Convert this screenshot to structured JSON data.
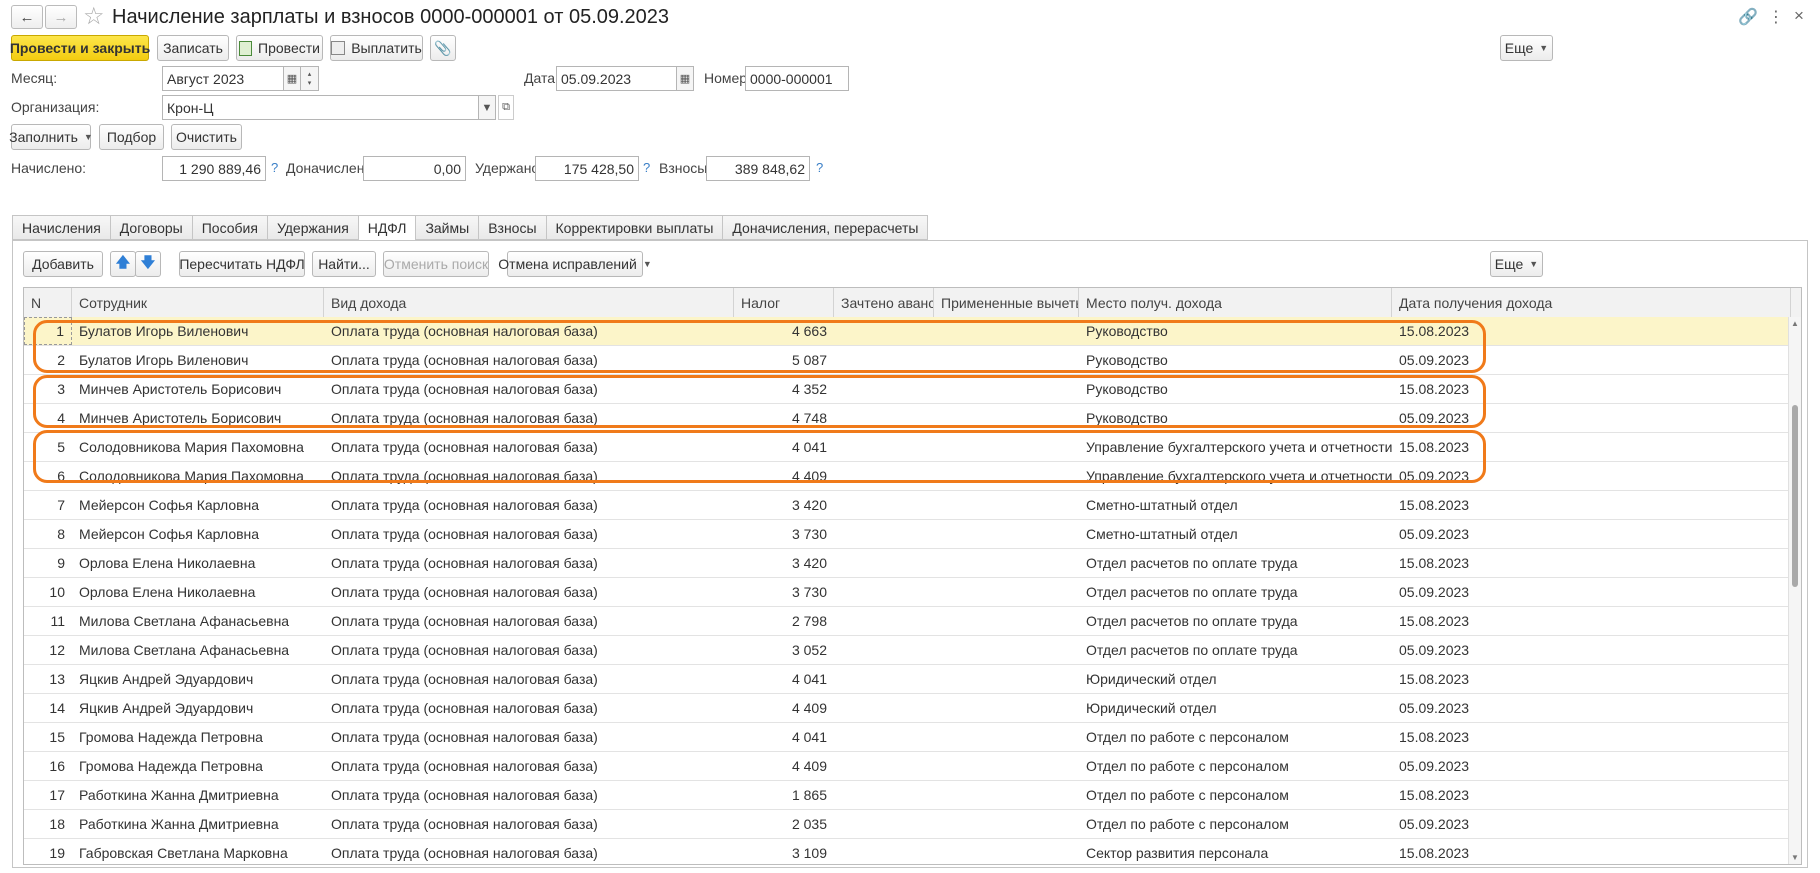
{
  "window": {
    "title": "Начисление зарплаты и взносов 0000-000001 от 05.09.2023",
    "more_label": "Еще"
  },
  "toolbar": {
    "post_close": "Провести и закрыть",
    "save": "Записать",
    "post": "Провести",
    "pay": "Выплатить",
    "more": "Еще"
  },
  "form": {
    "month_label": "Месяц:",
    "month_value": "Август 2023",
    "date_label": "Дата:",
    "date_value": "05.09.2023",
    "number_label": "Номер:",
    "number_value": "0000-000001",
    "org_label": "Организация:",
    "org_value": "Крон-Ц"
  },
  "actions": {
    "fill": "Заполнить",
    "select": "Подбор",
    "clear": "Очистить"
  },
  "totals": {
    "accrued_label": "Начислено:",
    "accrued_value": "1 290 889,46",
    "extra_label": "Доначислено:",
    "extra_value": "0,00",
    "withheld_label": "Удержано:",
    "withheld_value": "175 428,50",
    "contrib_label": "Взносы:",
    "contrib_value": "389 848,62",
    "q": "?"
  },
  "tabs": [
    "Начисления",
    "Договоры",
    "Пособия",
    "Удержания",
    "НДФЛ",
    "Займы",
    "Взносы",
    "Корректировки выплаты",
    "Доначисления, перерасчеты"
  ],
  "active_tab": 4,
  "table_toolbar": {
    "add": "Добавить",
    "recalc": "Пересчитать НДФЛ",
    "find": "Найти...",
    "cancel_search": "Отменить поиск",
    "cancel_fix": "Отмена исправлений",
    "more": "Еще"
  },
  "table": {
    "columns": [
      "N",
      "Сотрудник",
      "Вид дохода",
      "Налог",
      "Зачтено авансов",
      "Примененные вычеты",
      "Место получ. дохода",
      "Дата получения дохода"
    ],
    "rows": [
      [
        "1",
        "Булатов Игорь Виленович",
        "Оплата труда (основная налоговая база)",
        "4 663",
        "",
        "",
        "Руководство",
        "15.08.2023"
      ],
      [
        "2",
        "Булатов Игорь Виленович",
        "Оплата труда (основная налоговая база)",
        "5 087",
        "",
        "",
        "Руководство",
        "05.09.2023"
      ],
      [
        "3",
        "Минчев Аристотель Борисович",
        "Оплата труда (основная налоговая база)",
        "4 352",
        "",
        "",
        "Руководство",
        "15.08.2023"
      ],
      [
        "4",
        "Минчев Аристотель Борисович",
        "Оплата труда (основная налоговая база)",
        "4 748",
        "",
        "",
        "Руководство",
        "05.09.2023"
      ],
      [
        "5",
        "Солодовникова Мария Пахомовна",
        "Оплата труда (основная налоговая база)",
        "4 041",
        "",
        "",
        "Управление бухгалтерского учета и отчетности",
        "15.08.2023"
      ],
      [
        "6",
        "Солодовникова Мария Пахомовна",
        "Оплата труда (основная налоговая база)",
        "4 409",
        "",
        "",
        "Управление бухгалтерского учета и отчетности",
        "05.09.2023"
      ],
      [
        "7",
        "Мейерсон Софья Карловна",
        "Оплата труда (основная налоговая база)",
        "3 420",
        "",
        "",
        "Сметно-штатный отдел",
        "15.08.2023"
      ],
      [
        "8",
        "Мейерсон Софья Карловна",
        "Оплата труда (основная налоговая база)",
        "3 730",
        "",
        "",
        "Сметно-штатный отдел",
        "05.09.2023"
      ],
      [
        "9",
        "Орлова Елена Николаевна",
        "Оплата труда (основная налоговая база)",
        "3 420",
        "",
        "",
        "Отдел расчетов по оплате труда",
        "15.08.2023"
      ],
      [
        "10",
        "Орлова Елена Николаевна",
        "Оплата труда (основная налоговая база)",
        "3 730",
        "",
        "",
        "Отдел расчетов по оплате труда",
        "05.09.2023"
      ],
      [
        "11",
        "Милова Светлана Афанасьевна",
        "Оплата труда (основная налоговая база)",
        "2 798",
        "",
        "",
        "Отдел расчетов по оплате труда",
        "15.08.2023"
      ],
      [
        "12",
        "Милова Светлана Афанасьевна",
        "Оплата труда (основная налоговая база)",
        "3 052",
        "",
        "",
        "Отдел расчетов по оплате труда",
        "05.09.2023"
      ],
      [
        "13",
        "Яцкив Андрей Эдуардович",
        "Оплата труда (основная налоговая база)",
        "4 041",
        "",
        "",
        "Юридический отдел",
        "15.08.2023"
      ],
      [
        "14",
        "Яцкив Андрей Эдуардович",
        "Оплата труда (основная налоговая база)",
        "4 409",
        "",
        "",
        "Юридический отдел",
        "05.09.2023"
      ],
      [
        "15",
        "Громова Надежда Петровна",
        "Оплата труда (основная налоговая база)",
        "4 041",
        "",
        "",
        "Отдел по работе с персоналом",
        "15.08.2023"
      ],
      [
        "16",
        "Громова Надежда Петровна",
        "Оплата труда (основная налоговая база)",
        "4 409",
        "",
        "",
        "Отдел по работе с персоналом",
        "05.09.2023"
      ],
      [
        "17",
        "Работкина Жанна Дмитриевна",
        "Оплата труда (основная налоговая база)",
        "1 865",
        "",
        "",
        "Отдел по работе с персоналом",
        "15.08.2023"
      ],
      [
        "18",
        "Работкина Жанна Дмитриевна",
        "Оплата труда (основная налоговая база)",
        "2 035",
        "",
        "",
        "Отдел по работе с персоналом",
        "05.09.2023"
      ],
      [
        "19",
        "Габровская Светлана Марковна",
        "Оплата труда (основная налоговая база)",
        "3 109",
        "",
        "",
        "Сектор развития персонала",
        "15.08.2023"
      ]
    ],
    "selected_row": 0
  },
  "colors": {
    "accent_yellow": "#f5d020",
    "highlight_orange": "#f07a1a",
    "selected_row": "#fcf5c9",
    "help_blue": "#3a7fc7"
  }
}
